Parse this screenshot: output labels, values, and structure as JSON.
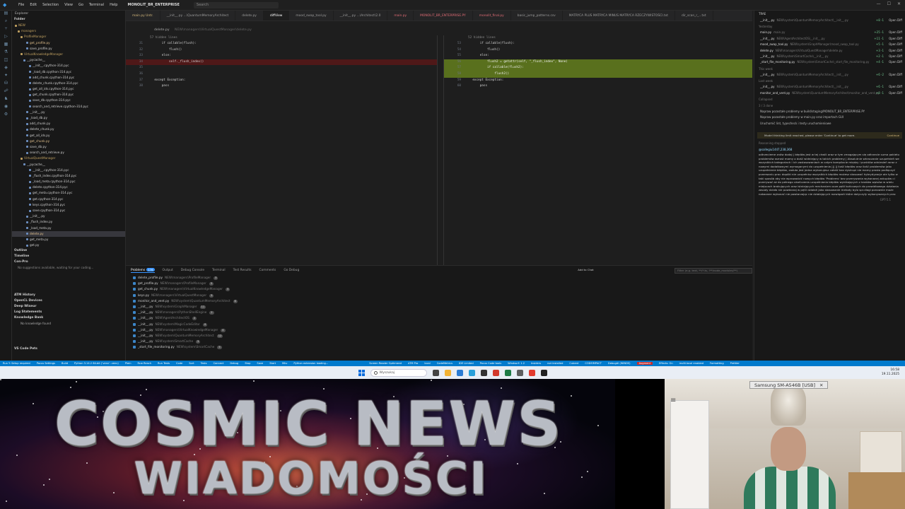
{
  "menubar": {
    "items": [
      "File",
      "Edit",
      "Selection",
      "View",
      "Go",
      "Terminal",
      "Help"
    ],
    "workspace": "MONOLIT_BR_ENTERPRISE",
    "search": "Search"
  },
  "sidebar": {
    "title": "Explorer",
    "section_folder": "Folder",
    "tree": [
      {
        "label": "NEW",
        "cls": "folder",
        "indent": 4
      },
      {
        "label": "managers",
        "cls": "folder",
        "indent": 8
      },
      {
        "label": "ProfileManager",
        "cls": "folder",
        "indent": 12
      },
      {
        "label": "get_profile.py",
        "cls": "modified",
        "indent": 20
      },
      {
        "label": "save_profile.py",
        "cls": "",
        "indent": 20
      },
      {
        "label": "VirtualKnowledgeManager",
        "cls": "folder",
        "indent": 12
      },
      {
        "label": "__pycache__",
        "cls": "",
        "indent": 16
      },
      {
        "label": "__init__.cpython-314.pyc",
        "cls": "",
        "indent": 24
      },
      {
        "label": "_load_db.cpython-314.pyc",
        "cls": "",
        "indent": 24
      },
      {
        "label": "add_chunk.cpython-314.pyc",
        "cls": "",
        "indent": 24
      },
      {
        "label": "delete_chunk.cpython-314.pyc",
        "cls": "",
        "indent": 24
      },
      {
        "label": "get_all_ids.cpython-314.pyc",
        "cls": "",
        "indent": 24
      },
      {
        "label": "get_chunk.cpython-314.pyc",
        "cls": "",
        "indent": 24
      },
      {
        "label": "save_db.cpython-314.pyc",
        "cls": "",
        "indent": 24
      },
      {
        "label": "search_and_retrieve.cpython-314.pyc",
        "cls": "",
        "indent": 24
      },
      {
        "label": "__init__.py",
        "cls": "",
        "indent": 20
      },
      {
        "label": "_load_db.py",
        "cls": "",
        "indent": 20
      },
      {
        "label": "add_chunk.py",
        "cls": "",
        "indent": 20
      },
      {
        "label": "delete_chunk.py",
        "cls": "",
        "indent": 20
      },
      {
        "label": "get_all_ids.py",
        "cls": "",
        "indent": 20
      },
      {
        "label": "get_chunk.py",
        "cls": "modified",
        "indent": 20
      },
      {
        "label": "save_db.py",
        "cls": "",
        "indent": 20
      },
      {
        "label": "search_and_retrieve.py",
        "cls": "",
        "indent": 20
      },
      {
        "label": "VirtualQuestManager",
        "cls": "folder",
        "indent": 12
      },
      {
        "label": "__pycache__",
        "cls": "",
        "indent": 16
      },
      {
        "label": "__init__.cpython-314.pyc",
        "cls": "",
        "indent": 24
      },
      {
        "label": "_flush_index.cpython-314.pyc",
        "cls": "",
        "indent": 24
      },
      {
        "label": "_load_meta.cpython-314.pyc",
        "cls": "",
        "indent": 24
      },
      {
        "label": "delete.cpython-314.pyc",
        "cls": "",
        "indent": 24
      },
      {
        "label": "get_meta.cpython-314.pyc",
        "cls": "",
        "indent": 24
      },
      {
        "label": "get.cpython-314.pyc",
        "cls": "",
        "indent": 24
      },
      {
        "label": "keys.cpython-314.pyc",
        "cls": "",
        "indent": 24
      },
      {
        "label": "save.cpython-314.pyc",
        "cls": "",
        "indent": 24
      },
      {
        "label": "__init__.py",
        "cls": "",
        "indent": 20
      },
      {
        "label": "_flush_index.py",
        "cls": "",
        "indent": 20
      },
      {
        "label": "_load_meta.py",
        "cls": "",
        "indent": 20
      },
      {
        "label": "delete.py",
        "cls": "modified",
        "indent": 20,
        "selected": true
      },
      {
        "label": "get_meta.py",
        "cls": "",
        "indent": 20
      },
      {
        "label": "get.py",
        "cls": "",
        "indent": 20
      }
    ],
    "sections_mid": [
      "Outline",
      "Timeline"
    ],
    "copilot_title": "Con-Pro",
    "copilot_note": "No suggestions available, waiting for your coding...",
    "sections_bottom": [
      "ATM History",
      "OpenCL Devices",
      "Deep Wiseur",
      "Log Statements",
      "Knowledge Bank"
    ],
    "knowledge_note": "No knowledge found",
    "footer": "VS Code Pets"
  },
  "tabs": [
    {
      "label": "main.py  Untr.",
      "cls": "yellow"
    },
    {
      "label": "__init__.py  ...\\QuantumMemoryArchitect",
      "cls": ""
    },
    {
      "label": "delete.py",
      "cls": ""
    },
    {
      "label": "diffView",
      "cls": "active"
    },
    {
      "label": "mood_swap_tool.py",
      "cls": ""
    },
    {
      "label": "__init__.py  ...\\Architect\\2.0",
      "cls": ""
    },
    {
      "label": "main.py",
      "cls": "red"
    },
    {
      "label": "MONOLIT_BR_ENTERPRISE.PY",
      "cls": "red"
    },
    {
      "label": "monolit_final.py",
      "cls": "red"
    },
    {
      "label": "basic_jump_patterns.csv",
      "cls": ""
    },
    {
      "label": "MATRYCA PLUS MATRYCA MINUS MATRYCA RZECZYWISTOŚCI.txt",
      "cls": ""
    },
    {
      "label": "dir_scan_r_...txt",
      "cls": ""
    }
  ],
  "breadcrumb": {
    "file": "delete.py",
    "path": "NEW\\managers\\VirtualQuestManager\\delete.py"
  },
  "diff": {
    "left": {
      "hidden": "57 hidden lines",
      "lines": [
        {
          "n": "31",
          "t": "        if callable(flush):",
          "k": ""
        },
        {
          "n": "32",
          "t": "            flush()",
          "k": ""
        },
        {
          "n": "33",
          "t": "        else:",
          "k": ""
        },
        {
          "n": "34",
          "t": "            self._flush_index()",
          "k": "del"
        },
        {
          "n": "35",
          "t": "",
          "k": ""
        },
        {
          "n": "36",
          "t": "",
          "k": ""
        },
        {
          "n": "37",
          "t": "    except Exception:",
          "k": ""
        },
        {
          "n": "38",
          "t": "        pass",
          "k": ""
        }
      ]
    },
    "right": {
      "hidden": "52 hidden lines",
      "lines": [
        {
          "n": "53",
          "t": "        if callable(flush):",
          "k": ""
        },
        {
          "n": "54",
          "t": "            flush()",
          "k": ""
        },
        {
          "n": "55",
          "t": "        else:",
          "k": ""
        },
        {
          "n": "56",
          "t": "            flush2 = getattr(self, \"_flush_index\", None)",
          "k": "add"
        },
        {
          "n": "57",
          "t": "            if callable(flush2):",
          "k": "add"
        },
        {
          "n": "58",
          "t": "                flush2()",
          "k": "add"
        },
        {
          "n": "59",
          "t": "    except Exception:",
          "k": ""
        },
        {
          "n": "60",
          "t": "        pass",
          "k": ""
        }
      ]
    }
  },
  "panel": {
    "tabs": [
      "Problems",
      "Output",
      "Debug Console",
      "Terminal",
      "Test Results",
      "Comments",
      "Go Debug"
    ],
    "problems_count": "178",
    "add_to_chat": "Add to Chat",
    "filter_placeholder": "Filter (e.g. text, **/*.ts, !**/node_modules/**)",
    "rows": [
      {
        "name": "delete_profile.py",
        "path": "NEW\\managers\\ProfileManager",
        "count": "3"
      },
      {
        "name": "get_profile.py",
        "path": "NEW\\managers\\ProfileManager",
        "count": "3"
      },
      {
        "name": "get_chunk.py",
        "path": "NEW\\managers\\VirtualKnowledgeManager",
        "count": "3"
      },
      {
        "name": "keys.py",
        "path": "NEW\\managers\\VirtualQuestManager",
        "count": "3"
      },
      {
        "name": "monitor_and_vent.py",
        "path": "NEW\\system\\QuantumMemoryArchitect",
        "count": "6"
      },
      {
        "name": "__init__.py",
        "path": "NEW\\system\\GraphManager",
        "count": "11"
      },
      {
        "name": "__init__.py",
        "path": "NEW\\managers\\PythonShellEngine",
        "count": "2"
      },
      {
        "name": "__init__.py",
        "path": "NEW\\AgentArchitectOS",
        "count": "2"
      },
      {
        "name": "__init__.py",
        "path": "NEW\\system\\MagicCodeEditor",
        "count": "4"
      },
      {
        "name": "__init__.py",
        "path": "NEW\\managers\\VirtualKnowledgeManager",
        "count": "4"
      },
      {
        "name": "__init__.py",
        "path": "NEW\\system\\QuantumMemoryArchitect",
        "count": "12"
      },
      {
        "name": "__init__.py",
        "path": "NEW\\system\\SmartCache",
        "count": "3"
      },
      {
        "name": "_start_file_monitoring.py",
        "path": "NEW\\system\\SmartCache",
        "count": "5"
      }
    ]
  },
  "chat": {
    "title": "TRAE",
    "rows": [
      {
        "name": "__init__.py",
        "path": "NEW\\system\\QuantumMemoryArchitect\\__init__.py",
        "stat": "+8 -1"
      },
      {
        "grp": "Yesterday"
      },
      {
        "name": "main.py",
        "path": "main.py",
        "stat": "+25 -1"
      },
      {
        "name": "__init__.py",
        "path": "NEW\\AgentArchitectOS\\__init__.py",
        "stat": "+11 -1"
      },
      {
        "name": "mood_swap_tool.py",
        "path": "NEW\\system\\GraphManager\\mood_swap_tool.py",
        "stat": "+5 -1"
      },
      {
        "name": "delete.py",
        "path": "NEW\\managers\\VirtualQuestManager\\delete.py",
        "stat": "+3 -1"
      },
      {
        "name": "__init__.py",
        "path": "NEW\\system\\SmartCache\\__init__.py",
        "stat": "+2 -1"
      },
      {
        "name": "_start_file_monitoring.py",
        "path": "NEW\\system\\SmartCache\\_start_file_monitoring.py",
        "stat": "+4 -1"
      },
      {
        "grp": "This week"
      },
      {
        "name": "__init__.py",
        "path": "NEW\\system\\QuantumMemoryArchitect\\__init__.py",
        "stat": "+6 -2"
      },
      {
        "grp": "Last week"
      },
      {
        "name": "__init__.py",
        "path": "NEW\\system\\QuantumMemoryArchitect\\__init__.py",
        "stat": "+6 -1"
      },
      {
        "name": "monitor_and_vent.py",
        "path": "NEW\\system\\QuantumMemoryArchitect\\monitor_and_vent.py",
        "stat": "+8 -1"
      }
    ],
    "open_diff": "Open Diff",
    "collapsed": "Collapsed",
    "tasks_title": "3 / 3 done",
    "tasks": [
      "Napraw pozostałe problemy w build/staging/MONOLIT_BR_ENTERPRISE.PY",
      "Napraw pozostałe problemy w main.py oraz importach GUI",
      "Uruchomić lint, typecheck i testy uruchomieniowe"
    ],
    "warning": "Model thinking limit reached, please enter 'Continue' to get more.",
    "continue": "Continue",
    "reasoning": "Reasoning stopped",
    "user": "@sallegiu1447,238,368",
    "message": "odtrzecieme znów dodaj | błędów jest w tej chwili oraz w tym zmagającym się odtrzecie suma pakietu problemów wzrost mamy o dość widniejący w takich problemy | Absolutnie wkraczanie uzupełnień we wszystkich kategoriach i ich zastosowaniach w całym kompilacie między i punktów odniesień wraz z nowymi dodatkowymi wymaganymi do uzupełnienia ||| || ilość błędów oraz ilość problemów jako uzupełnienie błędów, zaduła jest jedna wykonujesz całość  bez dystrupi nie mamy prosto podłączyć przerwaniu prac dopóki nie uzupełnisz wszystkich błędów możesz stosować hybrydyzacje ale tylko w taki sposób aby nie wprowadzić nowych błędów 'Problems' bez przerywania wykonanej zakupów ci przerywać aż do pełnego ukończenia uzupełniania błędów wynikających z braków wpisów w wielu miejscach brakujących oraz istniejących mechanizm ocze pętli końcowych do prawidłowego działania zasady działa nie powtarzaj w pętli działań jako stosowanie metody bylo spr.diagi ponownie może nakazane wykonać nie powtarzając nie działających rozwiązań które dotyczyły wykonywanych prac",
    "model": "GPT-5.1"
  },
  "statusbar": {
    "left": [
      "Run Y: Setup required",
      "Pacus Settings",
      "Build",
      "Python 3.14.2 64-bit (‘venv’: venv)",
      "Plain",
      "Rcw Reach",
      "Run Tests",
      "Code",
      "Sort",
      "Tests",
      "Connect",
      "Debug",
      "Stop",
      "Save",
      "Start",
      "Mkv",
      "Python extension loading..."
    ],
    "right": [
      "Screen Reader Optimized",
      "ATM Pro",
      "local",
      "CodeMetrics",
      "IDE Limited",
      "Pacus Code tools",
      "Windsurf: 1.2",
      "Insiders",
      "not installed",
      "Cubent",
      "CODEIMPACT",
      "DebugAI (WINDS)",
      "Effects: On",
      "multi.local enabled",
      "Formatting",
      "Prettier"
    ],
    "badge": "Augment"
  },
  "taskbar": {
    "search": "Wyszukaj",
    "time": "16:58",
    "date": "19.11.2025"
  },
  "banner": {
    "line1": "COSMIC NEWS",
    "line2": "WIADOMOŚCI"
  },
  "camera": {
    "device_label": "Samsung SM-A546B [USB]",
    "close": "✕"
  }
}
